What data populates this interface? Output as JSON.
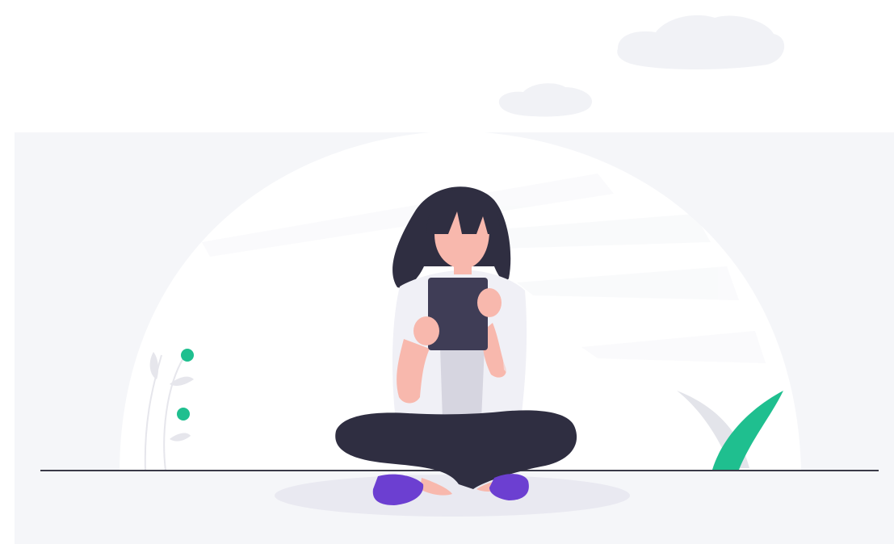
{
  "scene": {
    "subject": "woman-sitting-cross-legged-reading-tablet",
    "colors": {
      "background": "#ffffff",
      "panel": "#f5f6f9",
      "dome": "#ffffff",
      "cloud": "#f1f2f6",
      "ground_line": "#3a3a48",
      "shadow": "#e9e9f1",
      "hair": "#2f2e41",
      "skin": "#f8b8ad",
      "shirt": "#f0f0f6",
      "undershirt": "#d6d5e0",
      "pants": "#2f2e41",
      "tablet": "#3f3d56",
      "shoes": "#6c3fd1",
      "plant_green": "#1fbf8f",
      "plant_grey": "#e3e4ea",
      "stem": "#e6e6ec"
    },
    "icons": [
      "cloud-icon",
      "plant-icon",
      "leaf-icon",
      "tablet-icon"
    ]
  }
}
